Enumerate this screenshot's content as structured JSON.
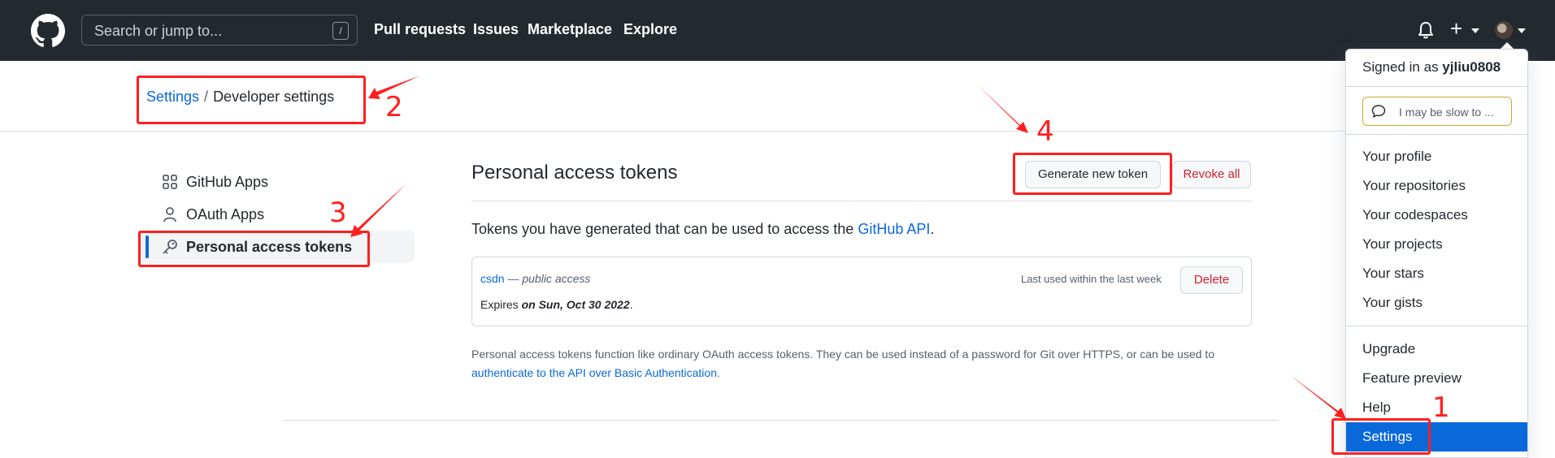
{
  "header": {
    "search_placeholder": "Search or jump to...",
    "search_shortcut": "/",
    "nav": [
      "Pull requests",
      "Issues",
      "Marketplace",
      "Explore"
    ],
    "plus_symbol": "+"
  },
  "breadcrumb": {
    "root": "Settings",
    "separator": "/",
    "current": "Developer settings"
  },
  "sidebar": {
    "items": [
      {
        "label": "GitHub Apps",
        "icon": "apps-grid-icon"
      },
      {
        "label": "OAuth Apps",
        "icon": "person-icon"
      },
      {
        "label": "Personal access tokens",
        "icon": "key-icon"
      }
    ]
  },
  "main": {
    "title": "Personal access tokens",
    "generate_label": "Generate new token",
    "revoke_label": "Revoke all",
    "intro_text": "Tokens you have generated that can be used to access the ",
    "intro_link": "GitHub API",
    "intro_end": ".",
    "token": {
      "name": "csdn",
      "scope": " — public access",
      "last_used": "Last used within the last week",
      "expires_prefix": "Expires ",
      "expires_date": "on Sun, Oct 30 2022",
      "expires_end": ".",
      "delete_label": "Delete"
    },
    "note_text": "Personal access tokens function like ordinary OAuth access tokens. They can be used instead of a password for Git over HTTPS, or can be used to ",
    "note_link": "authenticate to the API over Basic Authentication",
    "note_end": "."
  },
  "dropdown": {
    "signed_in_prefix": "Signed in as ",
    "username": "yjliu0808",
    "status_text": "I may be slow to ...",
    "group1": [
      "Your profile",
      "Your repositories",
      "Your codespaces",
      "Your projects",
      "Your stars",
      "Your gists"
    ],
    "group2": [
      "Upgrade",
      "Feature preview",
      "Help",
      "Settings"
    ]
  },
  "annotations": {
    "numbers": [
      "1",
      "2",
      "3",
      "4"
    ],
    "color": "#ff1f1f"
  },
  "colors": {
    "header_bg": "#24292f",
    "link": "#0969da",
    "danger": "#cf222e",
    "selected": "#0969da"
  }
}
